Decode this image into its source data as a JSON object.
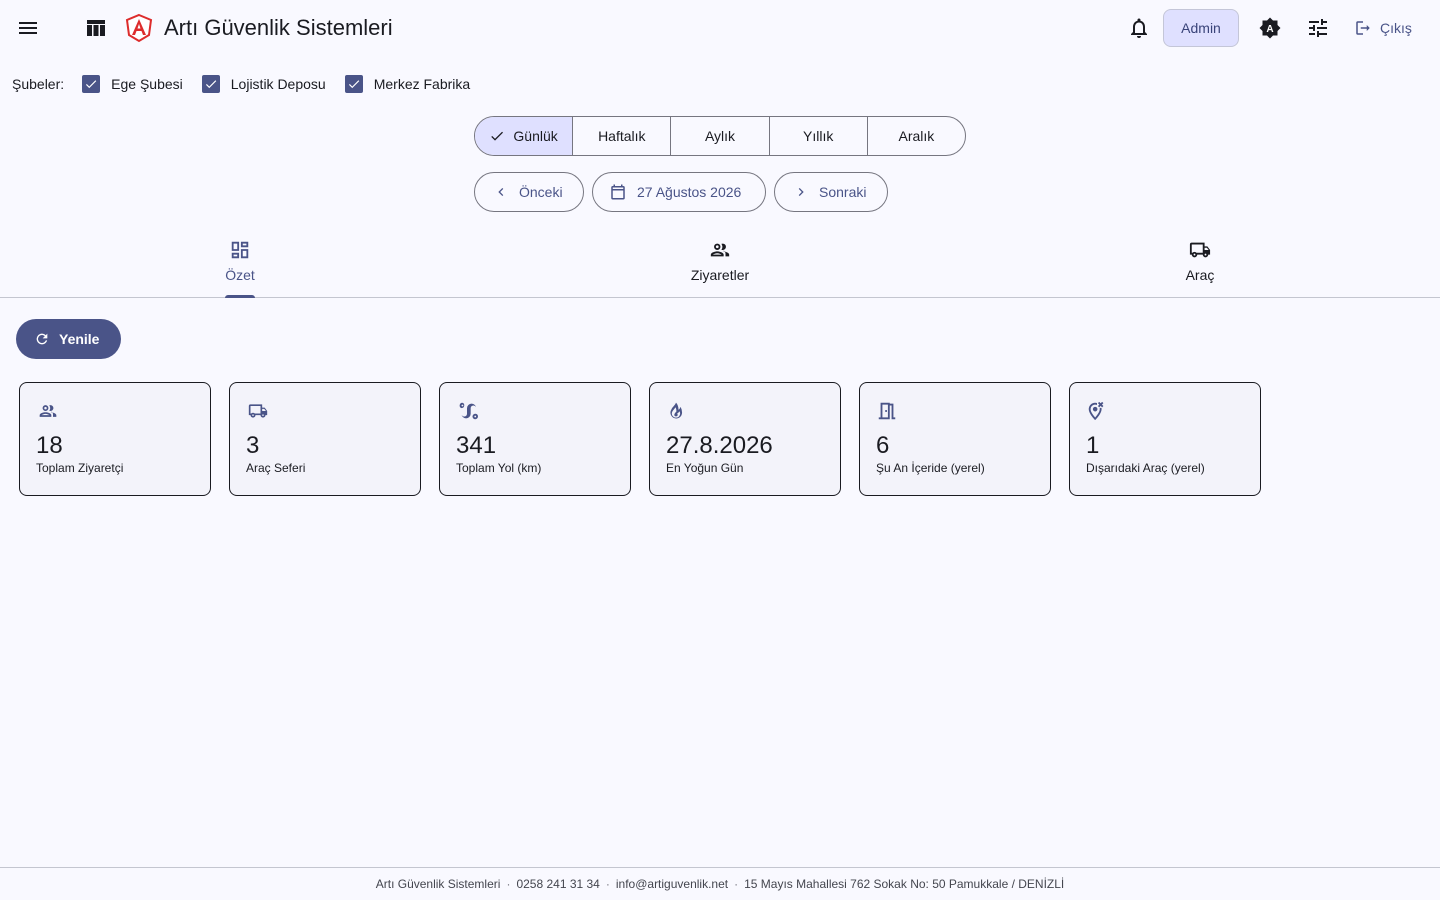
{
  "header": {
    "title": "Artı Güvenlik Sistemleri",
    "admin_label": "Admin",
    "logout_label": "Çıkış",
    "icons": [
      "menu-icon",
      "table-icon",
      "logo-icon",
      "bell-icon",
      "theme-icon",
      "tune-icon",
      "logout-icon"
    ]
  },
  "branches": {
    "label": "Şubeler:",
    "items": [
      {
        "label": "Ege Şubesi",
        "checked": true
      },
      {
        "label": "Lojistik Deposu",
        "checked": true
      },
      {
        "label": "Merkez Fabrika",
        "checked": true
      }
    ]
  },
  "period": {
    "options": [
      "Günlük",
      "Haftalık",
      "Aylık",
      "Yıllık",
      "Aralık"
    ],
    "selected": "Günlük"
  },
  "date_nav": {
    "prev_label": "Önceki",
    "date_label": "27 Ağustos 2026",
    "next_label": "Sonraki"
  },
  "tabs": [
    {
      "label": "Özet",
      "icon": "dashboard-icon",
      "active": true
    },
    {
      "label": "Ziyaretler",
      "icon": "people-icon",
      "active": false
    },
    {
      "label": "Araç",
      "icon": "truck-icon",
      "active": false
    }
  ],
  "refresh_label": "Yenile",
  "cards": [
    {
      "value": "18",
      "label": "Toplam Ziyaretçi",
      "icon": "people-icon"
    },
    {
      "value": "3",
      "label": "Araç Seferi",
      "icon": "truck-icon"
    },
    {
      "value": "341",
      "label": "Toplam Yol (km)",
      "icon": "route-icon"
    },
    {
      "value": "27.8.2026",
      "label": "En Yoğun Gün",
      "icon": "fire-icon"
    },
    {
      "value": "6",
      "label": "Şu An İçeride (yerel)",
      "icon": "door-icon"
    },
    {
      "value": "1",
      "label": "Dışarıdaki Araç (yerel)",
      "icon": "location-off-icon"
    }
  ],
  "footer": {
    "company": "Artı Güvenlik Sistemleri",
    "phone": "0258 241 31 34",
    "email": "info@artiguvenlik.net",
    "address": "15 Mayıs Mahallesi 762 Sokak No: 50 Pamukkale / DENİZLİ"
  },
  "colors": {
    "primary": "#4a5488",
    "primary_container": "#dfe0ff",
    "background": "#f9f9ff",
    "logo_red": "#dd2c2c"
  }
}
